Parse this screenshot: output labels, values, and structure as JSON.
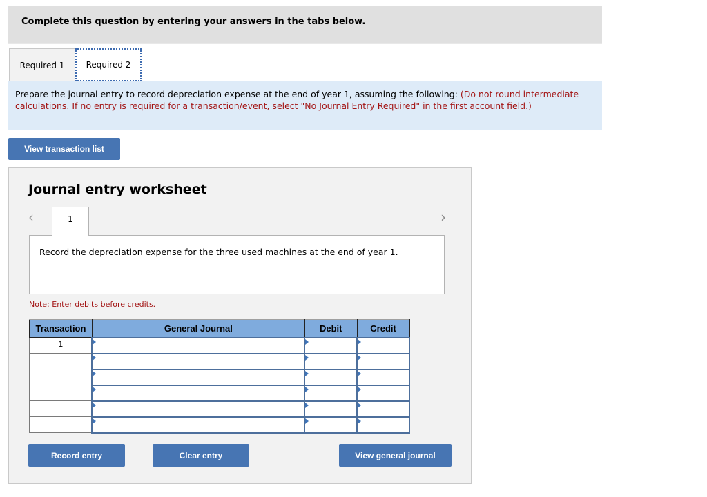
{
  "header": {
    "title": "Complete this question by entering your answers in the tabs below."
  },
  "tabs": [
    {
      "label": "Required 1",
      "active": false
    },
    {
      "label": "Required 2",
      "active": true
    }
  ],
  "instructions": {
    "text": "Prepare the journal entry to record depreciation expense at the end of year 1, assuming the following: ",
    "note": "(Do not round intermediate calculations. If no entry is required for a transaction/event, select \"No Journal Entry Required\" in the first account field.)"
  },
  "buttons": {
    "view_transaction_list": "View transaction list",
    "record_entry": "Record entry",
    "clear_entry": "Clear entry",
    "view_general_journal": "View general journal"
  },
  "worksheet": {
    "title": "Journal entry worksheet",
    "nav_prev_icon": "chevron-left-icon",
    "nav_next_icon": "chevron-right-icon",
    "entry_tab": "1",
    "description": "Record the depreciation expense for the three used machines at the end of year 1.",
    "note": "Note: Enter debits before credits.",
    "table": {
      "headers": [
        "Transaction",
        "General Journal",
        "Debit",
        "Credit"
      ],
      "rows": [
        {
          "transaction": "1",
          "account": "",
          "debit": "",
          "credit": ""
        },
        {
          "transaction": "",
          "account": "",
          "debit": "",
          "credit": ""
        },
        {
          "transaction": "",
          "account": "",
          "debit": "",
          "credit": ""
        },
        {
          "transaction": "",
          "account": "",
          "debit": "",
          "credit": ""
        },
        {
          "transaction": "",
          "account": "",
          "debit": "",
          "credit": ""
        },
        {
          "transaction": "",
          "account": "",
          "debit": "",
          "credit": ""
        }
      ]
    }
  },
  "colors": {
    "button": "#4775b3",
    "table_header": "#7fabdd",
    "instructions_bg": "#deebf8",
    "header_bg": "#e0e0e0",
    "note_red": "#a31515"
  }
}
